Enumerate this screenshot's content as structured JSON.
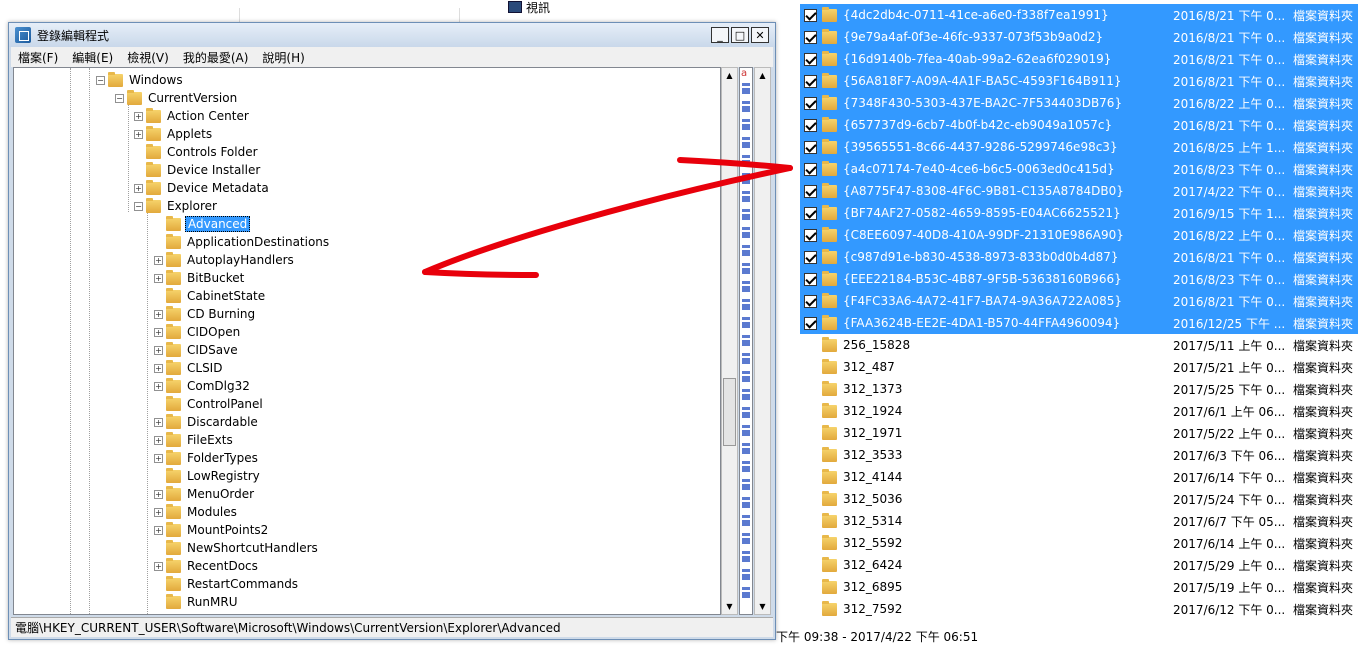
{
  "background": {
    "video_label": "視訊",
    "footer_text": "下午 09:38 - 2017/4/22 下午 06:51"
  },
  "window": {
    "title": "登錄編輯程式",
    "controls": {
      "minimize": "_",
      "maximize": "□",
      "close": "✕"
    },
    "menu": [
      "檔案(F)",
      "編輯(E)",
      "檢視(V)",
      "我的最愛(A)",
      "說明(H)"
    ],
    "status_path": "電腦\\HKEY_CURRENT_USER\\Software\\Microsoft\\Windows\\CurrentVersion\\Explorer\\Advanced",
    "right_pane_first": "a"
  },
  "tree": [
    {
      "label": "Windows",
      "level": 0,
      "exp": "-"
    },
    {
      "label": "CurrentVersion",
      "level": 1,
      "exp": "-"
    },
    {
      "label": "Action Center",
      "level": 2,
      "exp": "+"
    },
    {
      "label": "Applets",
      "level": 2,
      "exp": "+"
    },
    {
      "label": "Controls Folder",
      "level": 2,
      "exp": ""
    },
    {
      "label": "Device Installer",
      "level": 2,
      "exp": ""
    },
    {
      "label": "Device Metadata",
      "level": 2,
      "exp": "+"
    },
    {
      "label": "Explorer",
      "level": 2,
      "exp": "-"
    },
    {
      "label": "Advanced",
      "level": 3,
      "exp": "",
      "selected": true
    },
    {
      "label": "ApplicationDestinations",
      "level": 3,
      "exp": ""
    },
    {
      "label": "AutoplayHandlers",
      "level": 3,
      "exp": "+"
    },
    {
      "label": "BitBucket",
      "level": 3,
      "exp": "+"
    },
    {
      "label": "CabinetState",
      "level": 3,
      "exp": ""
    },
    {
      "label": "CD Burning",
      "level": 3,
      "exp": "+"
    },
    {
      "label": "CIDOpen",
      "level": 3,
      "exp": "+"
    },
    {
      "label": "CIDSave",
      "level": 3,
      "exp": "+"
    },
    {
      "label": "CLSID",
      "level": 3,
      "exp": "+"
    },
    {
      "label": "ComDlg32",
      "level": 3,
      "exp": "+"
    },
    {
      "label": "ControlPanel",
      "level": 3,
      "exp": ""
    },
    {
      "label": "Discardable",
      "level": 3,
      "exp": "+"
    },
    {
      "label": "FileExts",
      "level": 3,
      "exp": "+"
    },
    {
      "label": "FolderTypes",
      "level": 3,
      "exp": "+"
    },
    {
      "label": "LowRegistry",
      "level": 3,
      "exp": ""
    },
    {
      "label": "MenuOrder",
      "level": 3,
      "exp": "+"
    },
    {
      "label": "Modules",
      "level": 3,
      "exp": "+"
    },
    {
      "label": "MountPoints2",
      "level": 3,
      "exp": "+"
    },
    {
      "label": "NewShortcutHandlers",
      "level": 3,
      "exp": ""
    },
    {
      "label": "RecentDocs",
      "level": 3,
      "exp": "+"
    },
    {
      "label": "RestartCommands",
      "level": 3,
      "exp": ""
    },
    {
      "label": "RunMRU",
      "level": 3,
      "exp": ""
    }
  ],
  "files": [
    {
      "name": "{4dc2db4c-0711-41ce-a6e0-f338f7ea1991}",
      "date": "2016/8/21 下午 0...",
      "type": "檔案資料夾",
      "selected": true
    },
    {
      "name": "{9e79a4af-0f3e-46fc-9337-073f53b9a0d2}",
      "date": "2016/8/21 下午 0...",
      "type": "檔案資料夾",
      "selected": true
    },
    {
      "name": "{16d9140b-7fea-40ab-99a2-62ea6f029019}",
      "date": "2016/8/21 下午 0...",
      "type": "檔案資料夾",
      "selected": true
    },
    {
      "name": "{56A818F7-A09A-4A1F-BA5C-4593F164B911}",
      "date": "2016/8/21 下午 0...",
      "type": "檔案資料夾",
      "selected": true
    },
    {
      "name": "{7348F430-5303-437E-BA2C-7F534403DB76}",
      "date": "2016/8/22 上午 0...",
      "type": "檔案資料夾",
      "selected": true
    },
    {
      "name": "{657737d9-6cb7-4b0f-b42c-eb9049a1057c}",
      "date": "2016/8/21 下午 0...",
      "type": "檔案資料夾",
      "selected": true
    },
    {
      "name": "{39565551-8c66-4437-9286-5299746e98c3}",
      "date": "2016/8/25 上午 1...",
      "type": "檔案資料夾",
      "selected": true
    },
    {
      "name": "{a4c07174-7e40-4ce6-b6c5-0063ed0c415d}",
      "date": "2016/8/23 下午 0...",
      "type": "檔案資料夾",
      "selected": true
    },
    {
      "name": "{A8775F47-8308-4F6C-9B81-C135A8784DB0}",
      "date": "2017/4/22 下午 0...",
      "type": "檔案資料夾",
      "selected": true
    },
    {
      "name": "{BF74AF27-0582-4659-8595-E04AC6625521}",
      "date": "2016/9/15 下午 1...",
      "type": "檔案資料夾",
      "selected": true
    },
    {
      "name": "{C8EE6097-40D8-410A-99DF-21310E986A90}",
      "date": "2016/8/22 上午 0...",
      "type": "檔案資料夾",
      "selected": true
    },
    {
      "name": "{c987d91e-b830-4538-8973-833b0d0b4d87}",
      "date": "2016/8/21 下午 0...",
      "type": "檔案資料夾",
      "selected": true
    },
    {
      "name": "{EEE22184-B53C-4B87-9F5B-53638160B966}",
      "date": "2016/8/23 下午 0...",
      "type": "檔案資料夾",
      "selected": true
    },
    {
      "name": "{F4FC33A6-4A72-41F7-BA74-9A36A722A085}",
      "date": "2016/8/21 下午 0...",
      "type": "檔案資料夾",
      "selected": true
    },
    {
      "name": "{FAA3624B-EE2E-4DA1-B570-44FFA4960094}",
      "date": "2016/12/25 下午 ...",
      "type": "檔案資料夾",
      "selected": true
    },
    {
      "name": "256_15828",
      "date": "2017/5/11 上午 0...",
      "type": "檔案資料夾",
      "selected": false
    },
    {
      "name": "312_487",
      "date": "2017/5/21 上午 0...",
      "type": "檔案資料夾",
      "selected": false
    },
    {
      "name": "312_1373",
      "date": "2017/5/25 下午 0...",
      "type": "檔案資料夾",
      "selected": false
    },
    {
      "name": "312_1924",
      "date": "2017/6/1 上午 06...",
      "type": "檔案資料夾",
      "selected": false
    },
    {
      "name": "312_1971",
      "date": "2017/5/22 上午 0...",
      "type": "檔案資料夾",
      "selected": false
    },
    {
      "name": "312_3533",
      "date": "2017/6/3 下午 06...",
      "type": "檔案資料夾",
      "selected": false
    },
    {
      "name": "312_4144",
      "date": "2017/6/14 下午 0...",
      "type": "檔案資料夾",
      "selected": false
    },
    {
      "name": "312_5036",
      "date": "2017/5/24 下午 0...",
      "type": "檔案資料夾",
      "selected": false
    },
    {
      "name": "312_5314",
      "date": "2017/6/7 下午 05...",
      "type": "檔案資料夾",
      "selected": false
    },
    {
      "name": "312_5592",
      "date": "2017/6/14 上午 0...",
      "type": "檔案資料夾",
      "selected": false
    },
    {
      "name": "312_6424",
      "date": "2017/5/29 上午 0...",
      "type": "檔案資料夾",
      "selected": false
    },
    {
      "name": "312_6895",
      "date": "2017/5/19 上午 0...",
      "type": "檔案資料夾",
      "selected": false
    },
    {
      "name": "312_7592",
      "date": "2017/6/12 下午 0...",
      "type": "檔案資料夾",
      "selected": false
    }
  ],
  "colors": {
    "selection": "#3399ff",
    "annotation_arrow": "#e8000b"
  }
}
